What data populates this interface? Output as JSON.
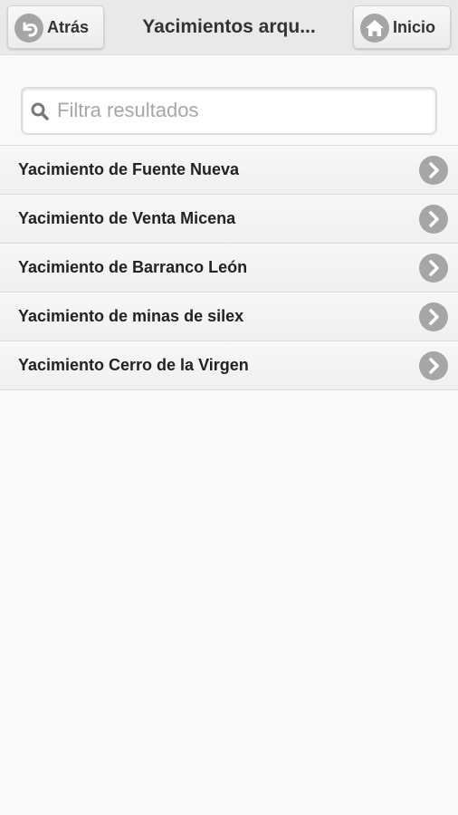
{
  "header": {
    "title": "Yacimientos arqu...",
    "back_label": "Atrás",
    "home_label": "Inicio",
    "back_icon": "undo-arrow-icon",
    "home_icon": "house-icon"
  },
  "search": {
    "placeholder": "Filtra resultados",
    "value": "",
    "icon": "search-icon"
  },
  "list": {
    "items": [
      {
        "label": "Yacimiento de Fuente Nueva"
      },
      {
        "label": "Yacimiento de Venta Micena"
      },
      {
        "label": "Yacimiento de Barranco León"
      },
      {
        "label": "Yacimiento de minas de silex"
      },
      {
        "label": "Yacimiento Cerro de la Virgen"
      }
    ],
    "item_icon": "chevron-right-icon"
  },
  "colors": {
    "header_bg": "#e9e9e9",
    "page_bg": "#f9f9f9",
    "icon_disc": "#a6a6a6",
    "text": "#333333"
  }
}
